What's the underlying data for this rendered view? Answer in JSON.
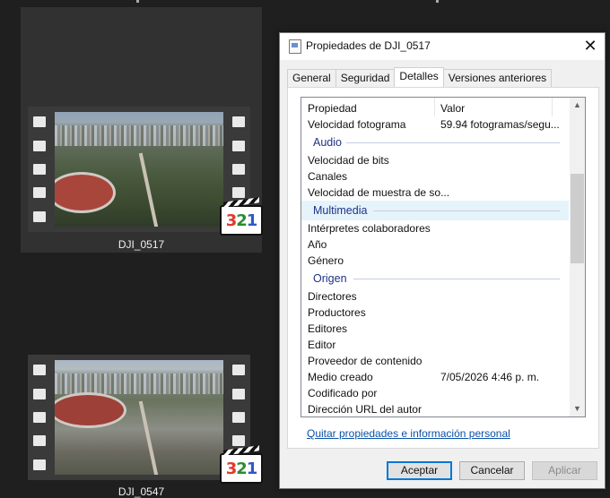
{
  "explorer": {
    "items": [
      {
        "name": "DJI_0517",
        "badge": [
          "3",
          "2",
          "1"
        ]
      },
      {
        "name": "DJI_0547",
        "badge": [
          "3",
          "2",
          "1"
        ]
      }
    ]
  },
  "dialog": {
    "title": "Propiedades de DJI_0517",
    "close_label": "✕",
    "tabs": [
      {
        "label": "General"
      },
      {
        "label": "Seguridad"
      },
      {
        "label": "Detalles"
      },
      {
        "label": "Versiones anteriores"
      }
    ],
    "active_tab": "Detalles",
    "columns": {
      "property": "Propiedad",
      "value": "Valor"
    },
    "rows": [
      {
        "name": "Velocidad fotograma",
        "value": "59.94 fotogramas/segu..."
      }
    ],
    "groups": [
      {
        "label": "Audio",
        "rows": [
          {
            "name": "Velocidad de bits",
            "value": ""
          },
          {
            "name": "Canales",
            "value": ""
          },
          {
            "name": "Velocidad de muestra de so...",
            "value": ""
          }
        ]
      },
      {
        "label": "Multimedia",
        "rows": [
          {
            "name": "Intérpretes colaboradores",
            "value": ""
          },
          {
            "name": "Año",
            "value": ""
          },
          {
            "name": "Género",
            "value": ""
          }
        ]
      },
      {
        "label": "Origen",
        "rows": [
          {
            "name": "Directores",
            "value": ""
          },
          {
            "name": "Productores",
            "value": ""
          },
          {
            "name": "Editores",
            "value": ""
          },
          {
            "name": "Editor",
            "value": ""
          },
          {
            "name": "Proveedor de contenido",
            "value": ""
          },
          {
            "name": "Medio creado",
            "value": "7/05/2026 4:46 p. m."
          },
          {
            "name": "Codificado por",
            "value": ""
          },
          {
            "name": "Dirección URL del autor",
            "value": ""
          }
        ]
      }
    ],
    "remove_link": "Quitar propiedades e información personal",
    "buttons": {
      "ok": "Aceptar",
      "cancel": "Cancelar",
      "apply": "Aplicar"
    }
  }
}
